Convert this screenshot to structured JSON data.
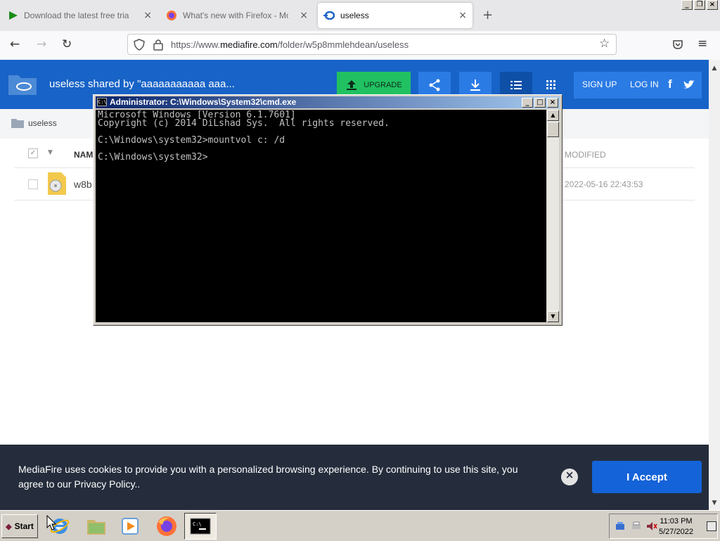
{
  "browser": {
    "tabs": [
      {
        "title": "Download the latest free trial versio",
        "close": "×"
      },
      {
        "title": "What's new with Firefox - More pri",
        "close": "×"
      },
      {
        "title": "useless",
        "close": "×"
      }
    ],
    "url_prefix": "https://www.",
    "url_domain": "mediafire.com",
    "url_path": "/folder/w5p8mmlehdean/useless"
  },
  "mediafire": {
    "folder_title": "useless  shared by \"aaaaaaaaaaa aaa...",
    "upgrade_label": "UPGRADE",
    "signup_label": "SIGN UP",
    "login_label": "LOG IN",
    "breadcrumb": "useless",
    "col_name": "NAM",
    "col_modified": "MODIFIED",
    "file_name": "w8b",
    "file_date": "2022-05-16 22:43:53"
  },
  "cookie": {
    "text": "MediaFire uses cookies to provide you with a personalized browsing experience. By continuing to use this site, you agree to our Privacy Policy..",
    "accept_label": "I Accept"
  },
  "cmd": {
    "title": "Administrator: C:\\Windows\\System32\\cmd.exe",
    "output": "Microsoft Windows [Version 6.1.7601]\nCopyright (c) 2014 DiLshad Sys.  All rights reserved.\n\nC:\\Windows\\system32>mountvol c: /d\n\nC:\\Windows\\system32>"
  },
  "taskbar": {
    "start_label": "Start",
    "time": "11:03 PM",
    "date": "5/27/2022"
  },
  "colors": {
    "mediafire_blue": "#1863c7",
    "upgrade_green": "#21c162",
    "cookie_bg": "#252d3c",
    "accept_blue": "#1463d8"
  }
}
